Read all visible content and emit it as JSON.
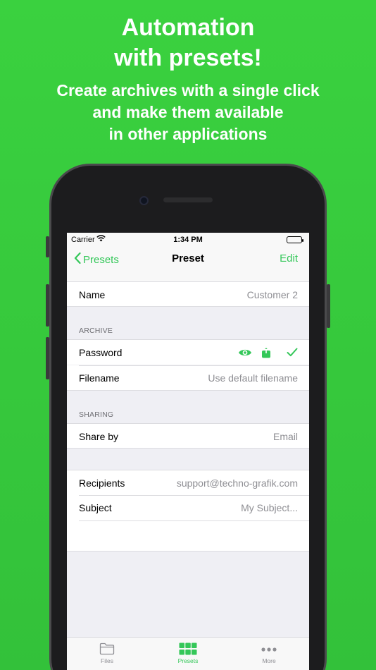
{
  "promo": {
    "headline_line1": "Automation",
    "headline_line2": "with presets!",
    "sub_line1": "Create archives with a single click",
    "sub_line2": "and make them available",
    "sub_line3": "in other applications"
  },
  "status_bar": {
    "carrier": "Carrier",
    "time": "1:34 PM"
  },
  "nav": {
    "back_label": "Presets",
    "title": "Preset",
    "edit_label": "Edit"
  },
  "form": {
    "name_label": "Name",
    "name_value": "Customer 2",
    "archive_header": "ARCHIVE",
    "password_label": "Password",
    "filename_label": "Filename",
    "filename_placeholder": "Use default filename",
    "sharing_header": "SHARING",
    "share_by_label": "Share by",
    "share_by_value": "Email",
    "recipients_label": "Recipients",
    "recipients_value": "support@techno-grafik.com",
    "subject_label": "Subject",
    "subject_placeholder": "My Subject..."
  },
  "tabs": {
    "files": "Files",
    "presets": "Presets",
    "more": "More"
  },
  "colors": {
    "background": "#36c83c",
    "accent": "#34c759"
  },
  "icons": [
    "wifi-icon",
    "battery-icon",
    "chevron-left-icon",
    "eye-icon",
    "share-icon",
    "checkmark-icon",
    "folder-icon",
    "grid-icon",
    "ellipsis-icon"
  ]
}
